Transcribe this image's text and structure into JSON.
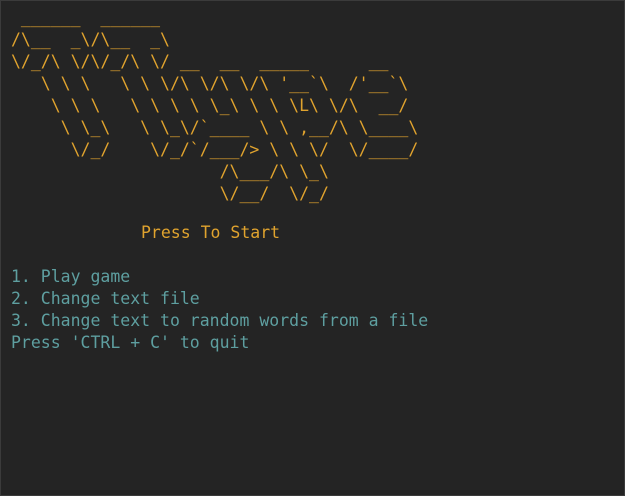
{
  "title_art": [
    " ______  ______",
    "/\\__  _\\/\\__  _\\",
    "\\/_/\\ \\/\\/_/\\ \\/ __  __  _____      __",
    "   \\ \\ \\   \\ \\ \\/\\ \\/\\ \\/\\ '__`\\  /'__`\\",
    "    \\ \\ \\   \\ \\ \\ \\ \\_\\ \\ \\ \\L\\ \\/\\  __/",
    "     \\ \\_\\   \\ \\_\\/`____ \\ \\ ,__/\\ \\____\\",
    "      \\/_/    \\/_/`/___/> \\ \\ \\/  \\/____/",
    "                     /\\___/\\ \\_\\",
    "                     \\/__/  \\/_/"
  ],
  "banner": "Press To Start",
  "menu": [
    {
      "label": "1. Play game"
    },
    {
      "label": "2. Change text file"
    },
    {
      "label": "3. Change text to random words from a file"
    },
    {
      "label": "Press 'CTRL + C' to quit"
    }
  ],
  "colors": {
    "background": "#242424",
    "art": "#e0a32e",
    "menu_text": "#5e9fa0"
  }
}
